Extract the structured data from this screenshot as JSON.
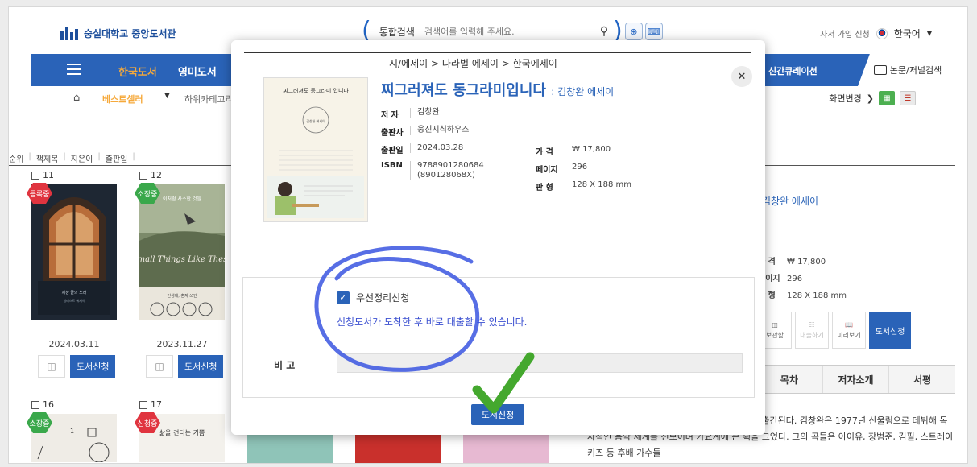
{
  "header": {
    "logo_text": "숭실대학교 중앙도서관",
    "search_label": "통합검색",
    "search_placeholder": "검색어를 입력해 주세요.",
    "signup": "사서 가입 신청",
    "language": "한국어"
  },
  "nav": {
    "items": [
      "한국도서",
      "영미도서"
    ],
    "curation": "신간큐레이션",
    "paper_search": "논문/저널검색"
  },
  "subnav": {
    "best": "베스트셀러",
    "category": "하위카테고리",
    "view_change": "화면변경"
  },
  "sortbar": [
    "순위",
    "책제목",
    "지은이",
    "출판일"
  ],
  "cards": [
    {
      "num": "11",
      "badge": "등록중",
      "badge_color": "#e0343f",
      "date": "2024.03.11",
      "apply": "도서신청"
    },
    {
      "num": "12",
      "badge": "소장중",
      "badge_color": "#3aa84b",
      "date": "2023.11.27",
      "apply": "도서신청"
    },
    {
      "num": "16",
      "badge": "소장중",
      "badge_color": "#3aa84b"
    },
    {
      "num": "17",
      "badge": "신청중",
      "badge_color": "#e0343f"
    }
  ],
  "covers": {
    "c11": {
      "title": "세상 끝의 노래",
      "sub": "일러스트 에세이"
    },
    "c12": {
      "title": "이처럼 사소한 것들",
      "en": "Small Things Like These",
      "note": "인생에, 혼자 쓰인"
    },
    "c17": {
      "title": "삶을 견디는 기쁨"
    }
  },
  "right": {
    "subtitle": "김창완 에세이",
    "price_label": "가 격",
    "price": "₩ 17,800",
    "pages_label": "페이지",
    "pages": "296",
    "size_label": "판 형",
    "size": "128 X 188 mm",
    "actions": [
      "보관함",
      "대출하기",
      "미리보기"
    ],
    "apply": "도서신청",
    "tabs": [
      "목차",
      "저자소개",
      "서평"
    ],
    "desc": "뮤지션 김창완의 에세이가 웅진지식하우스에서 출간된다. 김창완은 1977년 산울림으로 데뷔해 독자적인 음악 세계를 선보이며 가요계에 큰 획을 그었다. 그의 곡들은 아이유, 장범준, 김필, 스트레이 키즈 등 후배 가수들"
  },
  "modal": {
    "breadcrumb": "시/에세이 > 나라별 에세이 > 한국에세이",
    "title": "찌그러져도 동그라미입니다",
    "subtitle": ": 김창완 에세이",
    "author_label": "저 자",
    "author": "김창완",
    "publisher_label": "출판사",
    "publisher": "웅진지식하우스",
    "pubdate_label": "출판일",
    "pubdate": "2024.03.28",
    "isbn_label": "ISBN",
    "isbn": "9788901280684",
    "isbn2": "(890128068X)",
    "price_label": "가 격",
    "price": "₩ 17,800",
    "pages_label": "페이지",
    "pages": "296",
    "size_label": "판 형",
    "size": "128 X 188 mm",
    "cover_title": "찌그러져도 동그라미 입니다",
    "cover_author": "김창완 에세이",
    "priority_label": "우선정리신청",
    "priority_checked": true,
    "note": "신청도서가 도착한 후 바로 대출할 수 있습니다.",
    "memo_label": "비 고",
    "memo_value": "",
    "submit": "도서신청"
  },
  "colors": {
    "brand_blue": "#2a63b8",
    "accent_orange": "#f6a93b",
    "annotation_blue": "#3a55e0",
    "check_green": "#44a82e"
  }
}
